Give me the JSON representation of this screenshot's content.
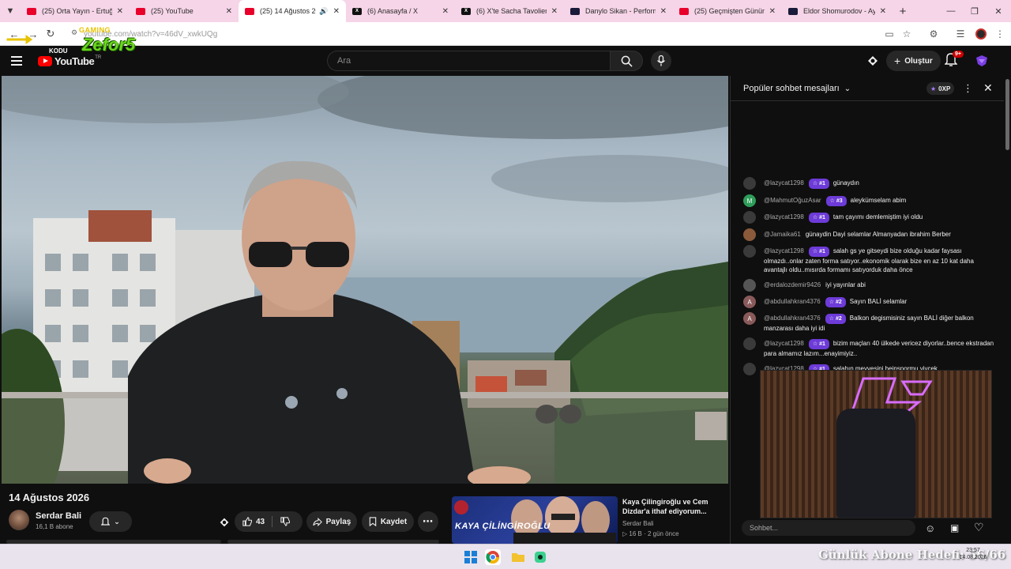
{
  "browser": {
    "tabs": [
      {
        "label": "(25) Orta Yayın - Ertuğrul",
        "type": "yt",
        "active": false
      },
      {
        "label": "(25) YouTube",
        "type": "yt",
        "active": false
      },
      {
        "label": "(25) 14 Ağustos 2026",
        "type": "yt",
        "active": true
      },
      {
        "label": "(6) Anasayfa / X",
        "type": "x",
        "active": false
      },
      {
        "label": "(6) X'te Sacha Tavolieri: \"",
        "type": "x",
        "active": false
      },
      {
        "label": "Danylo Sikan - Performan",
        "type": "dzn",
        "active": false
      },
      {
        "label": "(25) Geçmişten Günümüz",
        "type": "yt",
        "active": false
      },
      {
        "label": "Eldor Shomurodov - Ayrın",
        "type": "dzn",
        "active": false
      }
    ],
    "url": "youtube.com/watch?v=46dV_xwkUQg"
  },
  "overlay": {
    "brand_top": "GAMING",
    "brand_name": "Zefor5"
  },
  "youtube": {
    "logo_prefix": "KODU",
    "logo_word": "YouTube",
    "logo_region": "TR",
    "search_placeholder": "Ara",
    "create_label": "Oluştur",
    "notif_count": "9+"
  },
  "video": {
    "title": "14 Ağustos 2026",
    "channel": "Serdar Bali",
    "subscribers": "16,1 B abone",
    "likes": "43",
    "share_label": "Paylaş",
    "save_label": "Kaydet"
  },
  "recommended": {
    "title": "Kaya Çilingiroğlu ve Cem Dizdar'a ithaf ediyorum...",
    "channel": "Serdar Bali",
    "meta": "16 B · 2 gün önce",
    "thumb_text": "KAYA ÇİLİNGİROĞLU"
  },
  "chat": {
    "header": "Popüler sohbet mesajları",
    "xp": "0XP",
    "input_placeholder": "Sohbet...",
    "messages": [
      {
        "author": "@lazycat1298",
        "rank": "#1",
        "text": "günaydın",
        "avatar": "",
        "color": "#3a3a3a"
      },
      {
        "author": "@MahmutOğuzAsar",
        "rank": "#3",
        "text": "aleykümselam abim",
        "avatar": "M",
        "color": "#2e9e5a"
      },
      {
        "author": "@lazycat1298",
        "rank": "#1",
        "text": "tam çayımı demlemiştim iyi oldu",
        "avatar": "",
        "color": "#3a3a3a"
      },
      {
        "author": "@Jamaika61",
        "rank": "",
        "text": "günaydin Dayi selamlar Almanyadan ibrahim Berber",
        "avatar": "",
        "color": "#8a5a3a"
      },
      {
        "author": "@lazycat1298",
        "rank": "#1",
        "text": "salah gs ye gitseydi bize olduğu kadar faysası olmazdı..onlar zaten forma satıyor..ekonomik olarak bize en az 10 kat daha avantajlı oldu..mısırda formamı satıyorduk daha önce",
        "avatar": "",
        "color": "#3a3a3a"
      },
      {
        "author": "@erdalozdemir9426",
        "rank": "",
        "text": "iyi yayınlar abi",
        "avatar": "",
        "color": "#555"
      },
      {
        "author": "@abdullahkran4376",
        "rank": "#2",
        "text": "Sayın BALİ selamlar",
        "avatar": "A",
        "color": "#8a5a5a"
      },
      {
        "author": "@abdullahkran4376",
        "rank": "#2",
        "text": "Balkon degismisiniz sayın BALİ diğer balkon manzarası daha iyi idi",
        "avatar": "A",
        "color": "#8a5a5a"
      },
      {
        "author": "@lazycat1298",
        "rank": "#1",
        "text": "bizim maçları 40 ülkede vericez diyorlar..bence ekstradan para almamız lazım...enayimiyiz..",
        "avatar": "",
        "color": "#3a3a3a"
      },
      {
        "author": "@lazycat1298",
        "rank": "#1",
        "text": "salahın meyvesini beinspormu yiycek",
        "avatar": "",
        "color": "#3a3a3a"
      }
    ]
  },
  "stream_overlay": {
    "goal_text": "Günlük Abone Hedefi: 56/66",
    "time": "23:57",
    "date": "14.08.2026"
  }
}
